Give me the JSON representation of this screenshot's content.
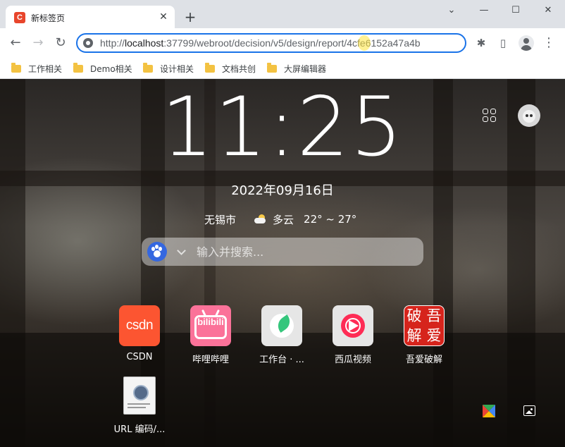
{
  "browser": {
    "tab": {
      "favicon_letter": "C",
      "title": "新标签页",
      "close_glyph": "✕"
    },
    "new_tab_glyph": "+",
    "window_controls": {
      "dropdown": "⌄",
      "minimize": "—",
      "maximize": "☐",
      "close": "✕"
    },
    "toolbar": {
      "back": "←",
      "forward": "→",
      "reload": "↻"
    },
    "address": {
      "scheme": "http://",
      "host": "localhost",
      "rest": ":37799/webroot/decision/v5/design/report/4cfe6152a47a4b"
    },
    "toolbar_icons": [
      "puzzle-icon",
      "side-panel-icon",
      "profile-icon",
      "kebab-menu-icon"
    ],
    "toolbar_glyphs": {
      "extensions": "✱",
      "side_panel": "▯",
      "menu": "⋮"
    },
    "bookmarks": [
      {
        "label": "工作相关"
      },
      {
        "label": "Demo相关"
      },
      {
        "label": "设计相关"
      },
      {
        "label": "文档共创"
      },
      {
        "label": "大屏编辑器"
      }
    ]
  },
  "newtab": {
    "clock": "11:25",
    "date": "2022年09月16日",
    "weather": {
      "city": "无锡市",
      "condition": "多云",
      "temperature": "22° ~ 27°"
    },
    "search": {
      "placeholder": "输入并搜索..."
    },
    "shortcuts": [
      {
        "label": "CSDN",
        "tile_text": "csdn"
      },
      {
        "label": "哔哩哔哩",
        "tile_text": "bilibili"
      },
      {
        "label": "工作台 · ..."
      },
      {
        "label": "西瓜视频"
      },
      {
        "label": "吾爱破解",
        "tile_chars": [
          "破",
          "吾",
          "解",
          "爱"
        ]
      },
      {
        "label": "URL 编码/..."
      }
    ]
  },
  "colors": {
    "accent": "#1a73e8",
    "csdn": "#fc5531",
    "bilibili": "#fb7299",
    "xigua": "#fe2c55",
    "wuai": "#d6241c",
    "folder": "#f3c242"
  }
}
